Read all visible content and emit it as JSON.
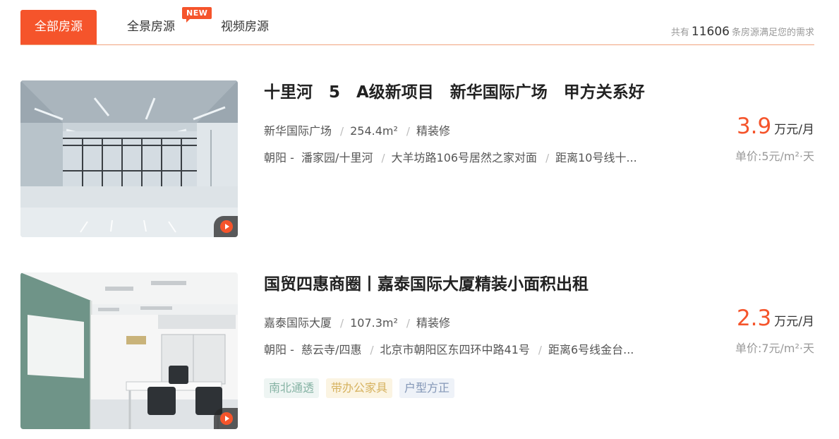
{
  "tabs": {
    "all": "全部房源",
    "panorama": "全景房源",
    "video": "视频房源",
    "new_badge": "NEW"
  },
  "summary": {
    "prefix": "共有",
    "count": "11606",
    "suffix": "条房源满足您的需求"
  },
  "listings": [
    {
      "title": "十里河　5　A级新项目　新华国际广场　甲方关系好",
      "building": "新华国际广场",
      "area": "254.4m²",
      "decoration": "精装修",
      "district": "朝阳 -",
      "subdistrict": "潘家园/十里河",
      "address": "大羊坊路106号居然之家对面",
      "subway": "距离10号线十...",
      "price": "3.9",
      "price_unit": "万元/月",
      "unit_price": "单价:5元/m²·天",
      "tags": []
    },
    {
      "title": "国贸四惠商圈丨嘉泰国际大厦精装小面积出租",
      "building": "嘉泰国际大厦",
      "area": "107.3m²",
      "decoration": "精装修",
      "district": "朝阳 -",
      "subdistrict": "慈云寺/四惠",
      "address": "北京市朝阳区东四环中路41号",
      "subway": "距离6号线金台...",
      "price": "2.3",
      "price_unit": "万元/月",
      "unit_price": "单价:7元/m²·天",
      "tags": [
        "南北通透",
        "带办公家具",
        "户型方正"
      ]
    }
  ],
  "colors": {
    "accent": "#f5542b",
    "divider": "#f0a37e"
  },
  "icons": {
    "video": "play-icon"
  }
}
